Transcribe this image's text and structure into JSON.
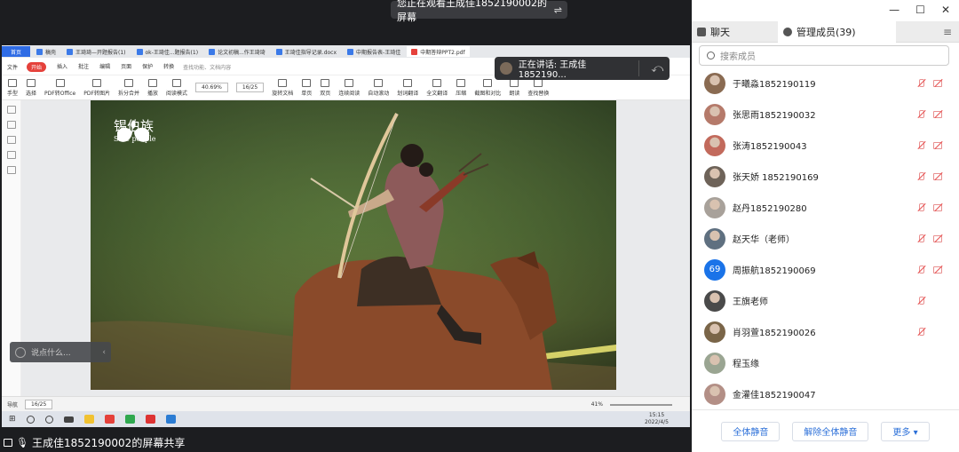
{
  "banner": {
    "text": "您正在观看王成佳1852190002的屏幕",
    "exit_icon": "exit-share-icon"
  },
  "wps": {
    "tabs": [
      {
        "label": "首页",
        "kind": "home"
      },
      {
        "label": "稿壳",
        "kind": "normal"
      },
      {
        "label": "王琦琦—开题报告(1)",
        "kind": "normal"
      },
      {
        "label": "ok-王琦佳...题报告(1)",
        "kind": "normal"
      },
      {
        "label": "论文初稿...作王琦琦",
        "kind": "normal"
      },
      {
        "label": "王琦佳指导记录.docx",
        "kind": "normal"
      },
      {
        "label": "中期报告表-王琦佳",
        "kind": "normal"
      },
      {
        "label": "中期答辩PPT2.pdf",
        "kind": "active"
      }
    ],
    "menu": {
      "file": "文件",
      "items": [
        "开始",
        "插入",
        "批注",
        "编辑",
        "页面",
        "保护",
        "转换"
      ],
      "active": "开始",
      "search_placeholder": "查找功能、文档内容"
    },
    "toolbar": {
      "items": [
        "手型",
        "选择",
        "PDF转Office",
        "PDF转图片",
        "拆分合并",
        "播放",
        "阅读模式",
        "旋转文档",
        "单页",
        "双页",
        "连续阅读",
        "自动滚动",
        "划词翻译",
        "全文翻译",
        "压缩",
        "截图和对比",
        "朗读",
        "查找替换"
      ],
      "zoom": "40.69%",
      "page": "16/25"
    },
    "photo": {
      "brand": "锡伯族",
      "brand_sub": "Sibe people"
    },
    "status": {
      "nav": "导航",
      "page": "16/25",
      "zoom": "41%"
    },
    "clock": {
      "time": "15:15",
      "date": "2022/4/5"
    }
  },
  "speaking": {
    "label": "正在讲话: 王成佳1852190..."
  },
  "chat_input": {
    "placeholder": "说点什么..."
  },
  "share_label": "王成佳1852190002的屏幕共享",
  "panel": {
    "window_controls": [
      "—",
      "☐",
      "✕"
    ],
    "tabs": [
      {
        "label": "聊天"
      },
      {
        "label": "管理成员(39)"
      }
    ],
    "search_placeholder": "搜索成员",
    "members": [
      {
        "name": "于曦淼1852190119",
        "avatar": "photo",
        "color": "#8a6b52",
        "mic": true,
        "cam": true
      },
      {
        "name": "张思雨1852190032",
        "avatar": "photo",
        "color": "#b57a6a",
        "mic": true,
        "cam": true
      },
      {
        "name": "张涛1852190043",
        "avatar": "photo",
        "color": "#c26a5c",
        "mic": true,
        "cam": true
      },
      {
        "name": "张天娇 1852190169",
        "avatar": "photo",
        "color": "#6e6359",
        "mic": true,
        "cam": true
      },
      {
        "name": "赵丹1852190280",
        "avatar": "photo",
        "color": "#a8a19a",
        "mic": true,
        "cam": true
      },
      {
        "name": "赵天华（老师）",
        "avatar": "photo",
        "color": "#5f7080",
        "mic": true,
        "cam": true
      },
      {
        "name": "周振航1852190069",
        "avatar": "number",
        "text": "69",
        "color": "#1a73e8",
        "mic": true,
        "cam": true
      },
      {
        "name": "王旗老师",
        "avatar": "photo",
        "color": "#4a4a4a",
        "mic": true,
        "cam": false
      },
      {
        "name": "肖羽萱1852190026",
        "avatar": "photo",
        "color": "#7a6548",
        "mic": true,
        "cam": false
      },
      {
        "name": "程玉缘",
        "avatar": "photo",
        "color": "#9aa592",
        "mic": false,
        "cam": false
      },
      {
        "name": "金灌佳1852190047",
        "avatar": "photo",
        "color": "#b38f86",
        "mic": false,
        "cam": false
      }
    ],
    "footer": [
      "全体静音",
      "解除全体静音",
      "更多 ▾"
    ]
  }
}
